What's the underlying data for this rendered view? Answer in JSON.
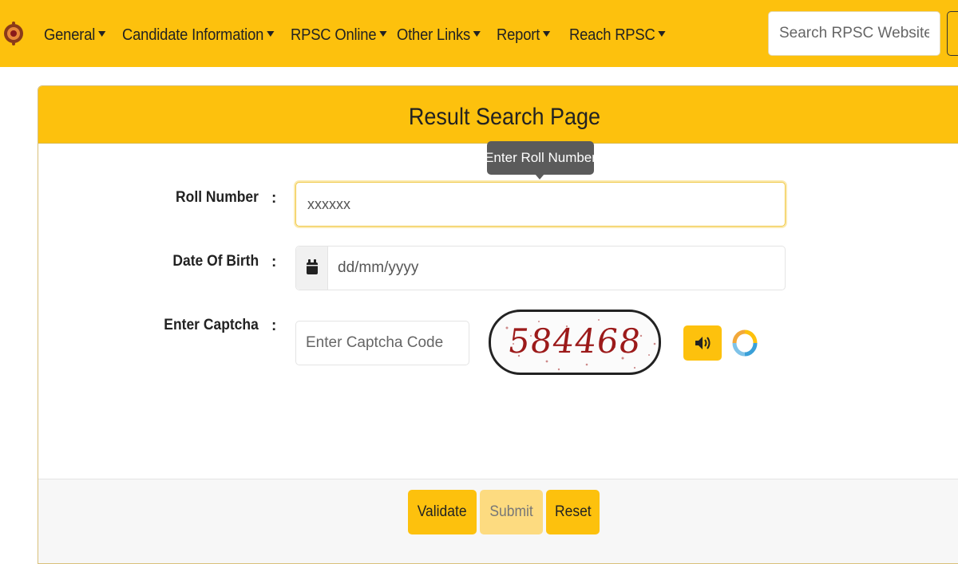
{
  "nav": {
    "items": [
      {
        "label": "General"
      },
      {
        "label": "Candidate Information"
      },
      {
        "label": "RPSC Online"
      },
      {
        "label": "Other Links"
      },
      {
        "label": "Report"
      },
      {
        "label": "Reach RPSC"
      }
    ],
    "search_placeholder": "Search RPSC Website"
  },
  "card": {
    "title": "Result Search Page"
  },
  "tooltip": {
    "text": "Enter Roll Number"
  },
  "form": {
    "roll_label": "Roll Number",
    "roll_value": "xxxxxx",
    "dob_label": "Date Of Birth",
    "dob_placeholder": "dd/mm/yyyy",
    "captcha_label": "Enter Captcha",
    "captcha_placeholder": "Enter Captcha Code",
    "captcha_code": "584468",
    "colon": ":"
  },
  "buttons": {
    "validate": "Validate",
    "submit": "Submit",
    "reset": "Reset"
  },
  "colors": {
    "brand_yellow": "#fdc10d",
    "captcha_red": "#9c1a1a"
  },
  "icons": {
    "logo": "rpsc-logo-icon",
    "calendar": "calendar-icon",
    "audio": "speaker-icon",
    "refresh": "refresh-icon"
  }
}
